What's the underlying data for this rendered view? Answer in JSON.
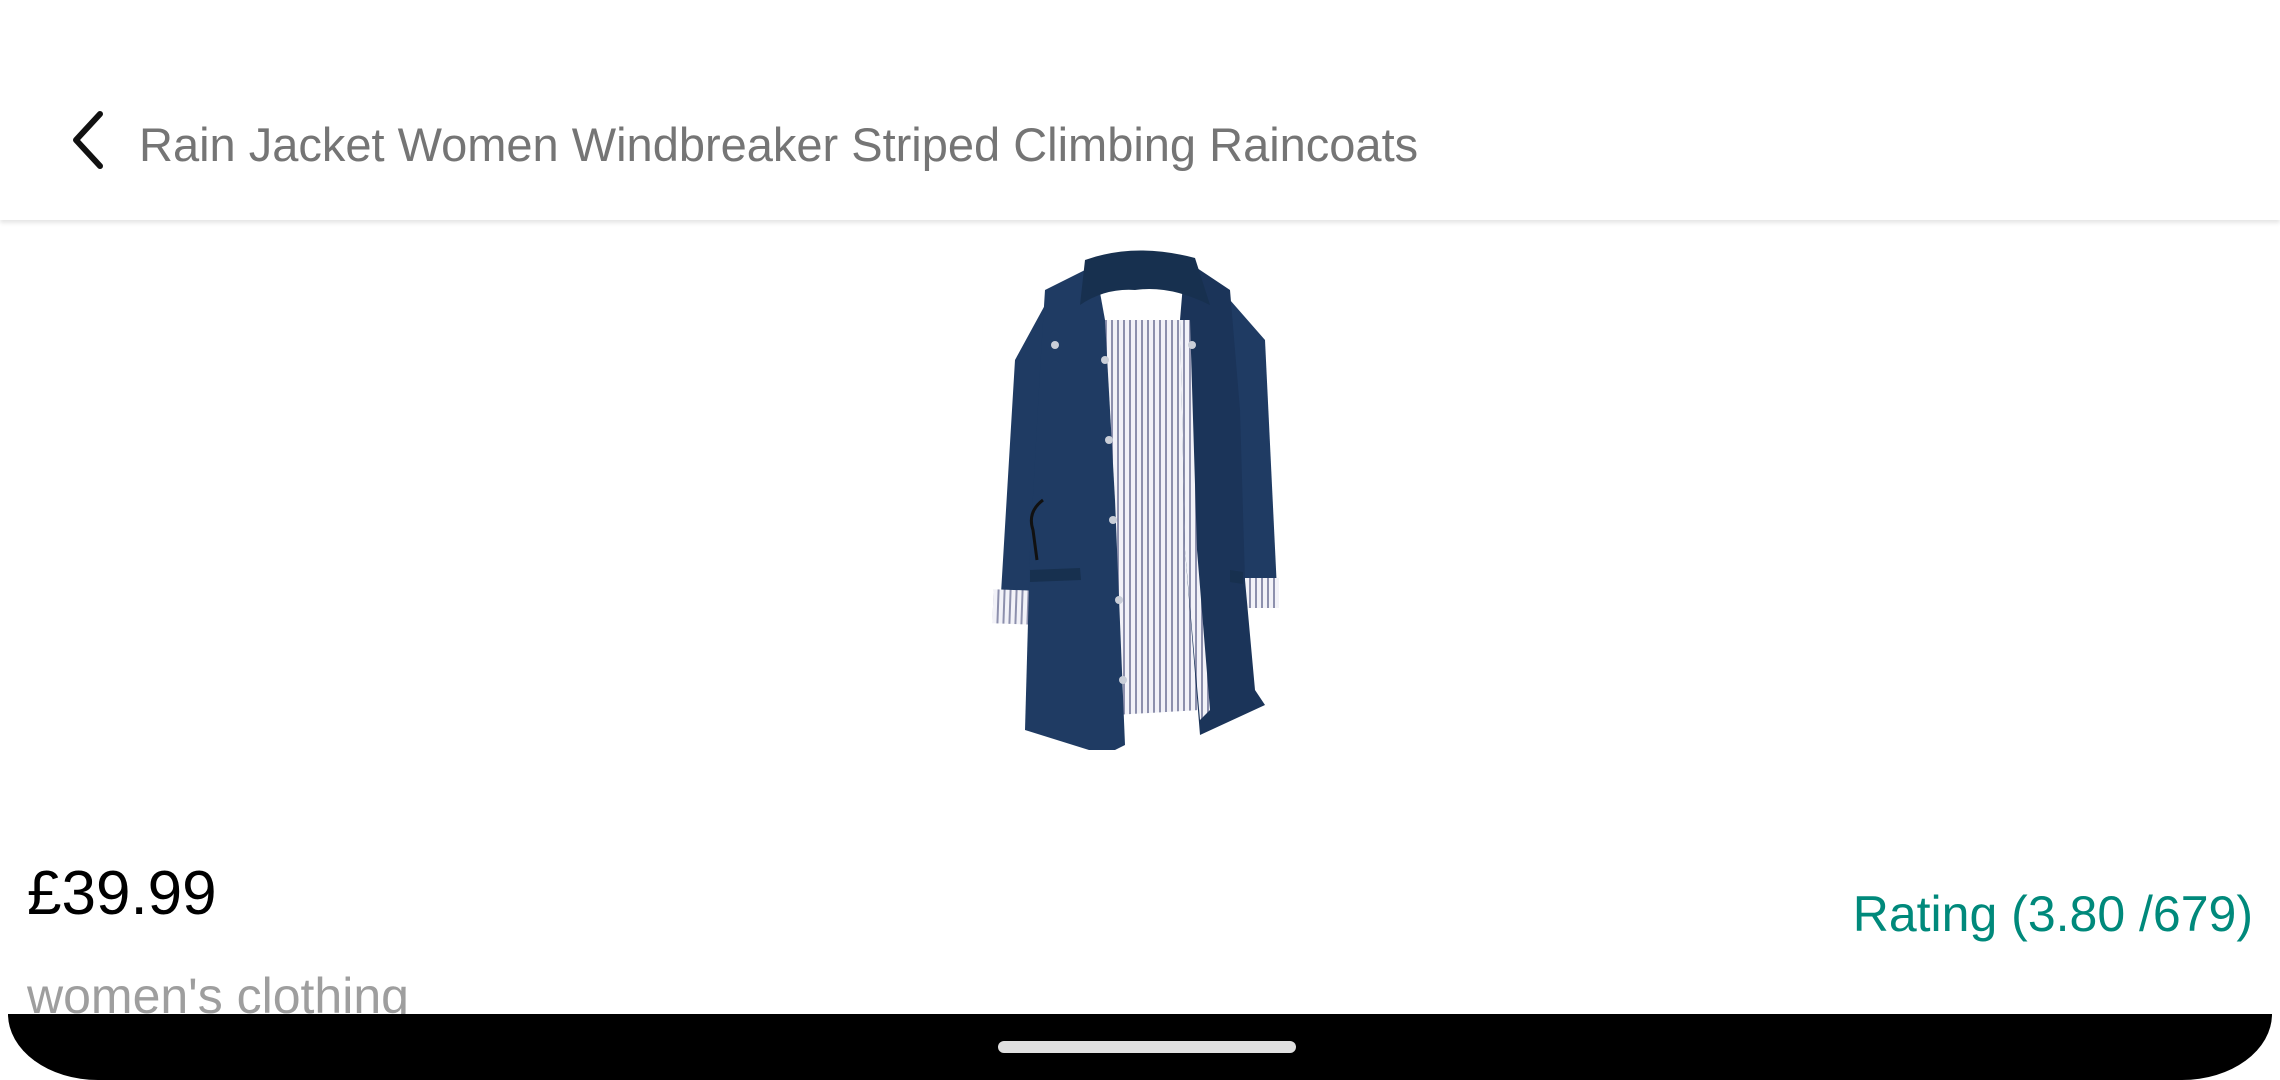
{
  "app_bar": {
    "title": "Rain Jacket Women Windbreaker Striped Climbing Raincoats",
    "back_icon": "chevron-left-icon"
  },
  "product": {
    "image": "navy-rain-jacket-with-striped-lining",
    "price": "£39.99",
    "rating": "Rating (3.80 /679)",
    "category": "women's clothing"
  },
  "colors": {
    "title_text": "#757575",
    "rating_text": "#00897b",
    "category_text": "#9e9e9e",
    "jacket": "#1f3b63"
  }
}
